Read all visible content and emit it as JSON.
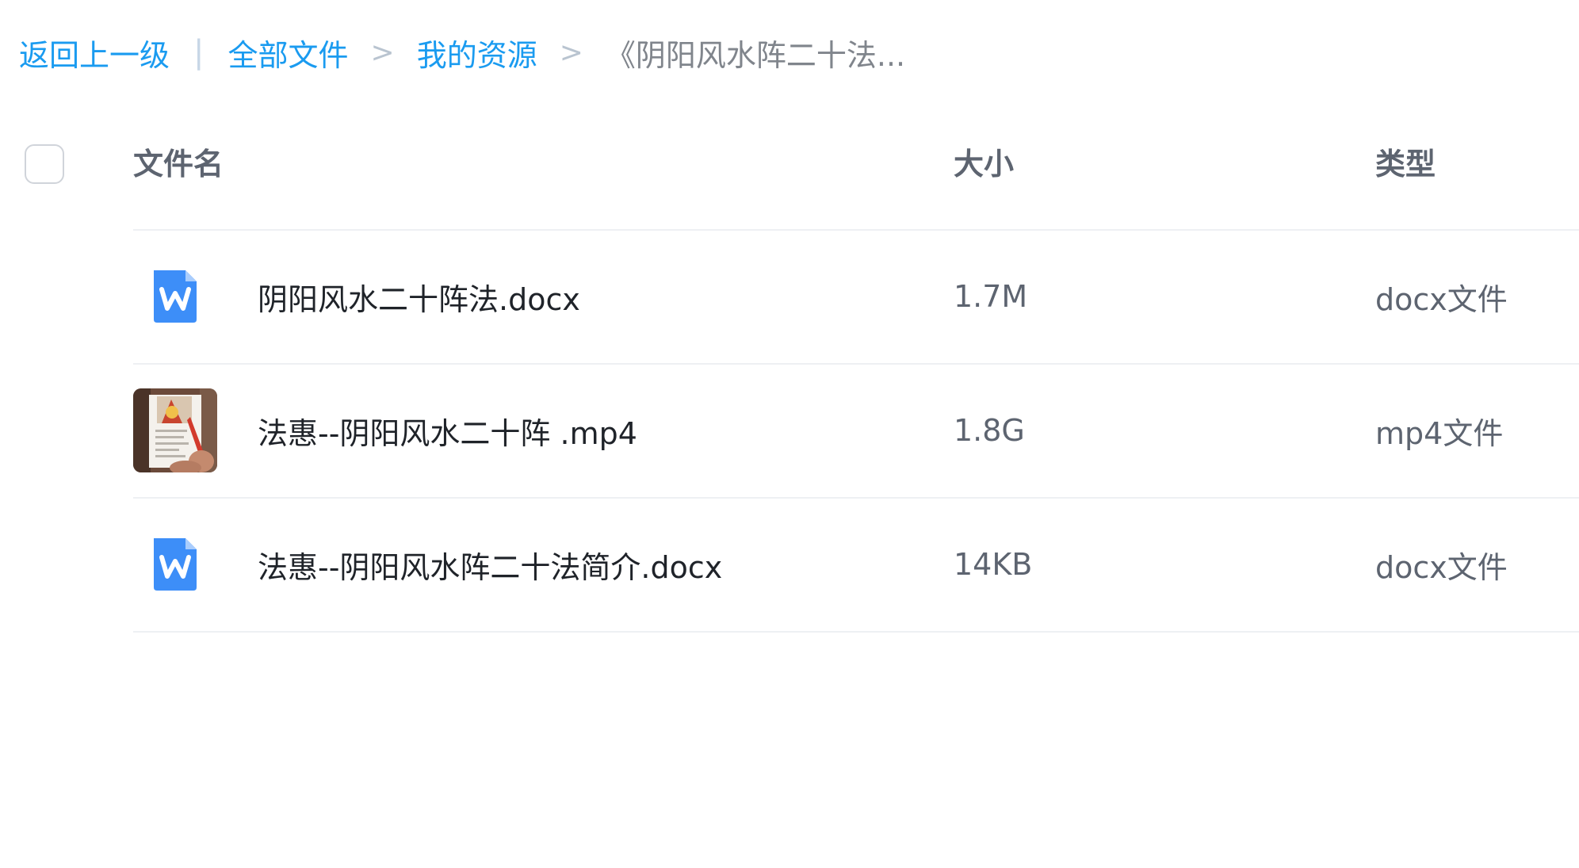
{
  "breadcrumb": {
    "back": "返回上一级",
    "all_files": "全部文件",
    "my_resources": "我的资源",
    "current": "《阴阳风水阵二十法..."
  },
  "table": {
    "headers": {
      "name": "文件名",
      "size": "大小",
      "type": "类型"
    },
    "rows": [
      {
        "name": "阴阳风水二十阵法.docx",
        "size": "1.7M",
        "type": "docx文件",
        "icon": "word-doc-icon"
      },
      {
        "name": "法惠--阴阳风水二十阵 .mp4",
        "size": "1.8G",
        "type": "mp4文件",
        "icon": "video-thumbnail"
      },
      {
        "name": "法惠--阴阳风水阵二十法简介.docx",
        "size": "14KB",
        "type": "docx文件",
        "icon": "word-doc-icon"
      }
    ]
  },
  "colors": {
    "link": "#1a9bf0",
    "word_icon": "#3d8ef8",
    "text_primary": "#1f2329",
    "text_secondary": "#5d6470"
  }
}
